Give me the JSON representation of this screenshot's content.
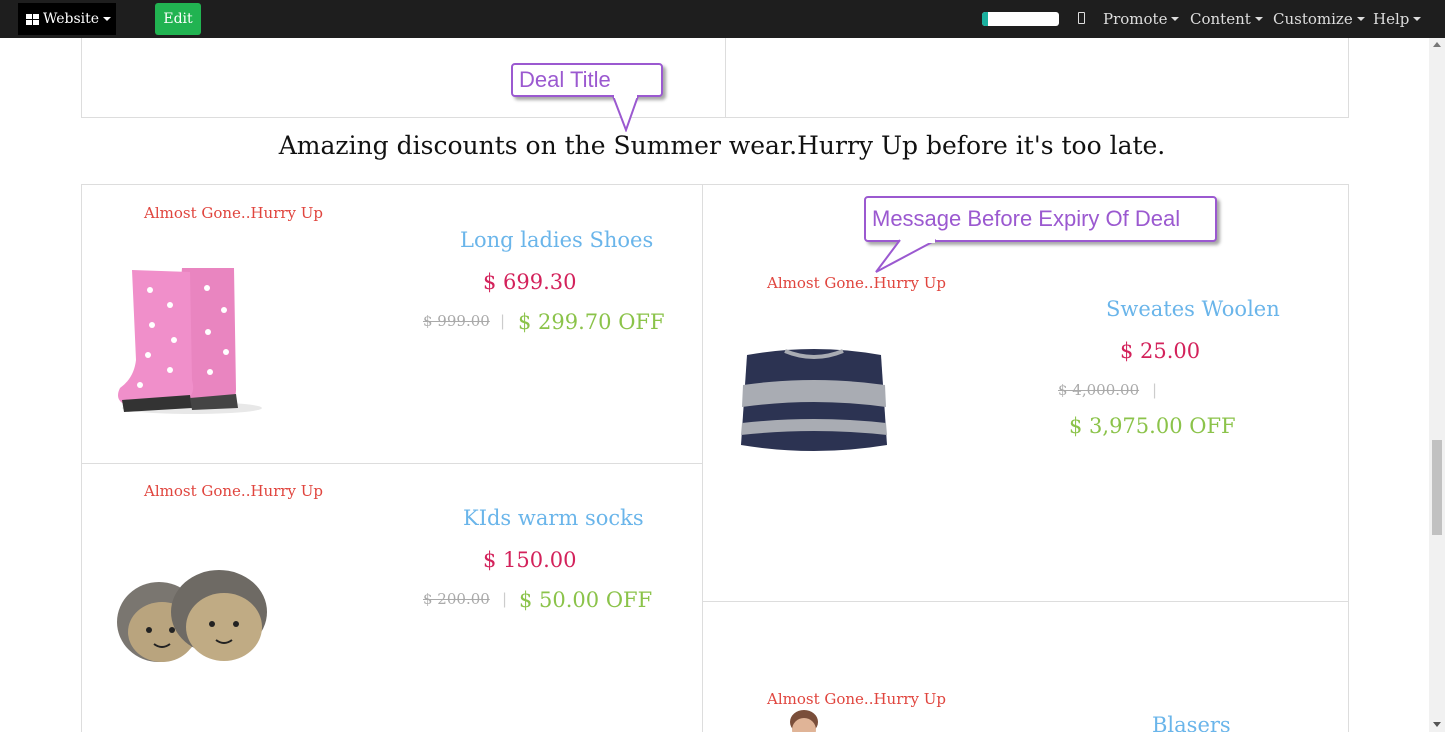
{
  "topbar": {
    "website_label": "Website",
    "edit_label": "Edit",
    "progress": 0.08,
    "menus": [
      "Promote",
      "Content",
      "Customize",
      "Help"
    ]
  },
  "deal": {
    "title": "Amazing discounts on the Summer wear.Hurry Up before it's too late."
  },
  "callouts": {
    "deal_title": "Deal Title",
    "expiry_message": "Message Before Expiry Of Deal"
  },
  "products": [
    {
      "badge": "Almost Gone..Hurry Up",
      "name": "Long ladies Shoes",
      "price": "$ 699.30",
      "old_price": "$ 999.00",
      "discount": "$ 299.70 OFF",
      "image": "pink-rain-boots"
    },
    {
      "badge": "Almost Gone..Hurry Up",
      "name": "Sweates Woolen",
      "price": "$ 25.00",
      "old_price": "$ 4,000.00",
      "discount": "$ 3,975.00 OFF",
      "image": "striped-sweater"
    },
    {
      "badge": "Almost Gone..Hurry Up",
      "name": "KIds warm socks",
      "price": "$ 150.00",
      "old_price": "$ 200.00",
      "discount": "$ 50.00 OFF",
      "image": "knitted-baby-booties"
    },
    {
      "badge": "Almost Gone..Hurry Up",
      "name": "Blasers",
      "image": "man-in-blazer"
    }
  ],
  "separator": "|",
  "colors": {
    "badge": "#e0453e",
    "name": "#6ab5ea",
    "price": "#d3225b",
    "discount": "#8bc34a",
    "callout": "#9b59d0",
    "edit_button": "#21b351"
  }
}
